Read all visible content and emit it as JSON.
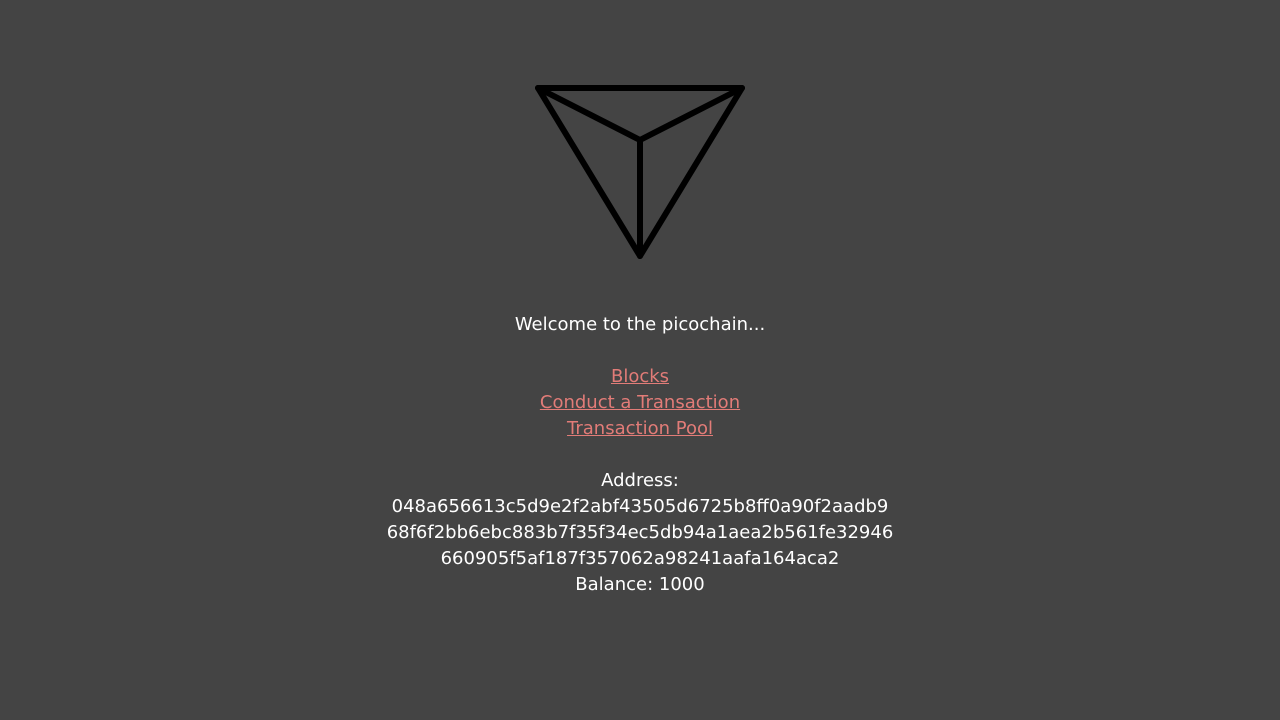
{
  "welcome_text": "Welcome to the picochain...",
  "nav": {
    "links": [
      {
        "label": "Blocks"
      },
      {
        "label": "Conduct a Transaction"
      },
      {
        "label": "Transaction Pool"
      }
    ]
  },
  "wallet": {
    "address_label": "Address:",
    "address_lines": [
      "048a656613c5d9e2f2abf43505d6725b8ff0a90f2aadb9",
      "68f6f2bb6ebc883b7f35f34ec5db94a1aea2b561fe32946",
      "660905f5af187f357062a98241aafa164aca2"
    ],
    "balance_text": "Balance: 1000"
  },
  "colors": {
    "background": "#444444",
    "text": "#ffffff",
    "link": "#e27c78",
    "logo_stroke": "#000000"
  },
  "icons": {
    "logo": "triangular-pyramid-logo-icon"
  }
}
